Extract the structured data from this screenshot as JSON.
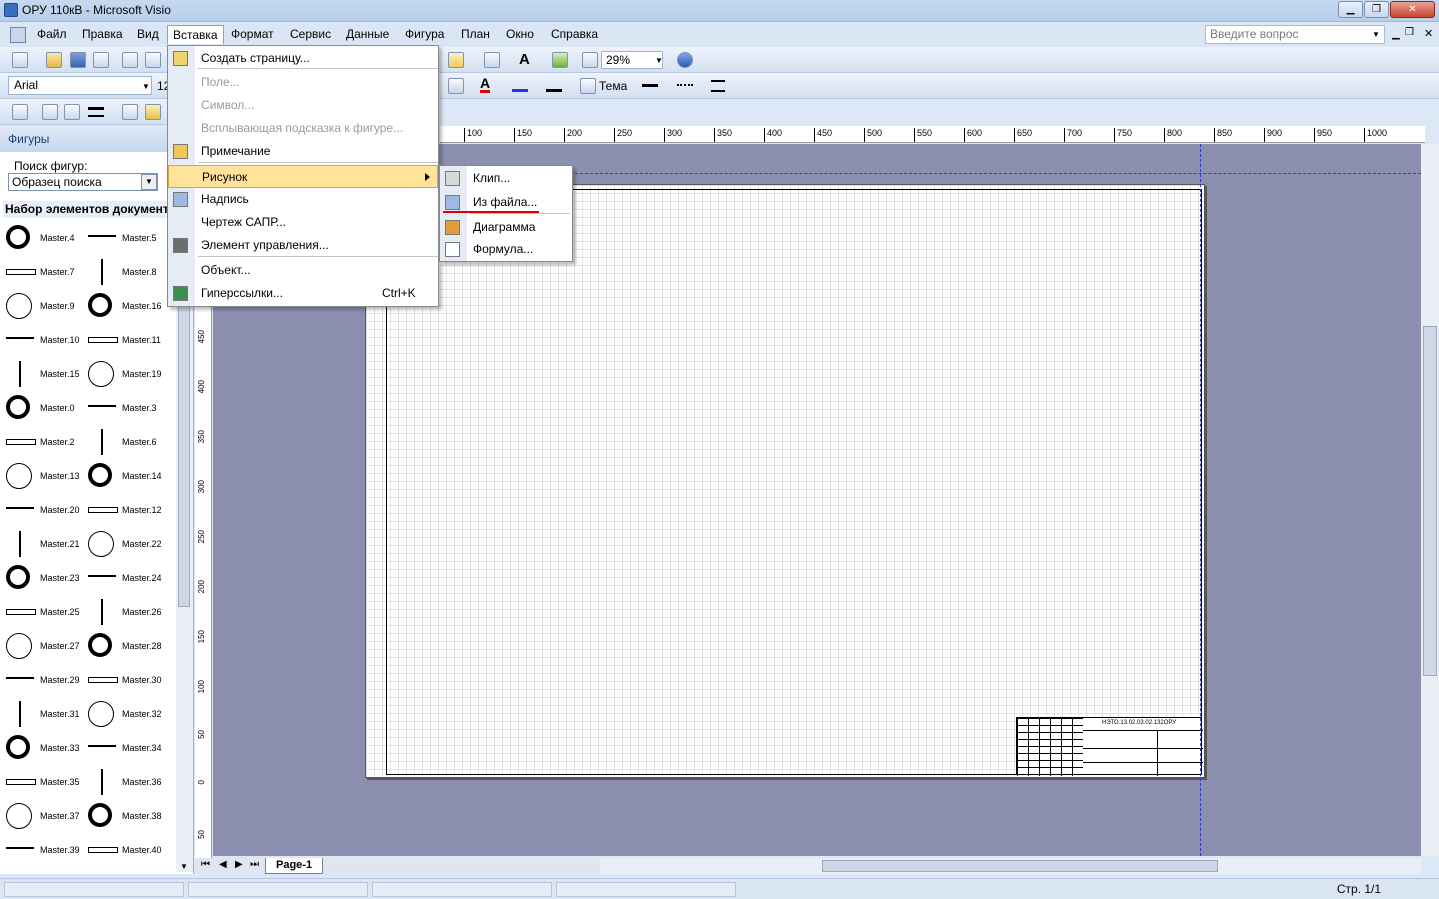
{
  "window": {
    "title": "ОРУ 110кВ - Microsoft Visio"
  },
  "menubar": {
    "items": [
      "Файл",
      "Правка",
      "Вид",
      "Вставка",
      "Формат",
      "Сервис",
      "Данные",
      "Фигура",
      "План",
      "Окно",
      "Справка"
    ],
    "help_placeholder": "Введите вопрос"
  },
  "toolbar": {
    "font": "Arial",
    "font_size": "12",
    "zoom": "29%",
    "theme_label": "Тема"
  },
  "shapes_panel": {
    "title": "Фигуры",
    "search_label": "Поиск фигур:",
    "search_value": "Образец поиска",
    "stencil_title": "Набор элементов документ",
    "masters": [
      [
        "Master.4",
        "Master.5"
      ],
      [
        "Master.7",
        "Master.8"
      ],
      [
        "Master.9",
        "Master.16"
      ],
      [
        "Master.10",
        "Master.11"
      ],
      [
        "Master.15",
        "Master.19"
      ],
      [
        "Master.0",
        "Master.3"
      ],
      [
        "Master.2",
        "Master.6"
      ],
      [
        "Master.13",
        "Master.14"
      ],
      [
        "Master.20",
        "Master.12"
      ],
      [
        "Master.21",
        "Master.22"
      ],
      [
        "Master.23",
        "Master.24"
      ],
      [
        "Master.25",
        "Master.26"
      ],
      [
        "Master.27",
        "Master.28"
      ],
      [
        "Master.29",
        "Master.30"
      ],
      [
        "Master.31",
        "Master.32"
      ],
      [
        "Master.33",
        "Master.34"
      ],
      [
        "Master.35",
        "Master.36"
      ],
      [
        "Master.37",
        "Master.38"
      ],
      [
        "Master.39",
        "Master.40"
      ]
    ]
  },
  "ruler": {
    "h_ticks": [
      "100",
      "150",
      "200",
      "250",
      "300",
      "350",
      "400",
      "450",
      "500",
      "550",
      "600",
      "650",
      "700",
      "750",
      "800",
      "850",
      "900",
      "950",
      "1000"
    ],
    "v_ticks": [
      "450",
      "400",
      "350",
      "300",
      "250",
      "200",
      "150",
      "100",
      "50",
      "0",
      "50"
    ]
  },
  "title_block": {
    "code": "НЭТО.13.02.03.02.132ОРУ"
  },
  "insert_menu": {
    "items": [
      {
        "label": "Создать страницу...",
        "disabled": false,
        "icon": "new-page-icon"
      },
      {
        "label": "Поле...",
        "disabled": true
      },
      {
        "label": "Символ...",
        "disabled": true
      },
      {
        "label": "Всплывающая подсказка к фигуре...",
        "disabled": true
      },
      {
        "label": "Примечание",
        "disabled": false,
        "icon": "comment-icon"
      },
      {
        "label": "Рисунок",
        "disabled": false,
        "submenu": true
      },
      {
        "label": "Надпись",
        "disabled": false,
        "icon": "textbox-icon"
      },
      {
        "label": "Чертеж САПР...",
        "disabled": false
      },
      {
        "label": "Элемент управления...",
        "disabled": false,
        "icon": "control-icon"
      },
      {
        "label": "Объект...",
        "disabled": false
      },
      {
        "label": "Гиперссылки...",
        "disabled": false,
        "shortcut": "Ctrl+K",
        "icon": "hyperlink-icon"
      }
    ]
  },
  "picture_submenu": {
    "items": [
      "Клип...",
      "Из файла...",
      "Диаграмма",
      "Формула..."
    ]
  },
  "tabs": {
    "page": "Page-1"
  },
  "status": {
    "page": "Стр. 1/1"
  },
  "colors": {
    "canvas": "#8d8fb0",
    "highlight": "#ffe39a",
    "guide": "#2b3cc8",
    "annotation": "#e00000"
  }
}
